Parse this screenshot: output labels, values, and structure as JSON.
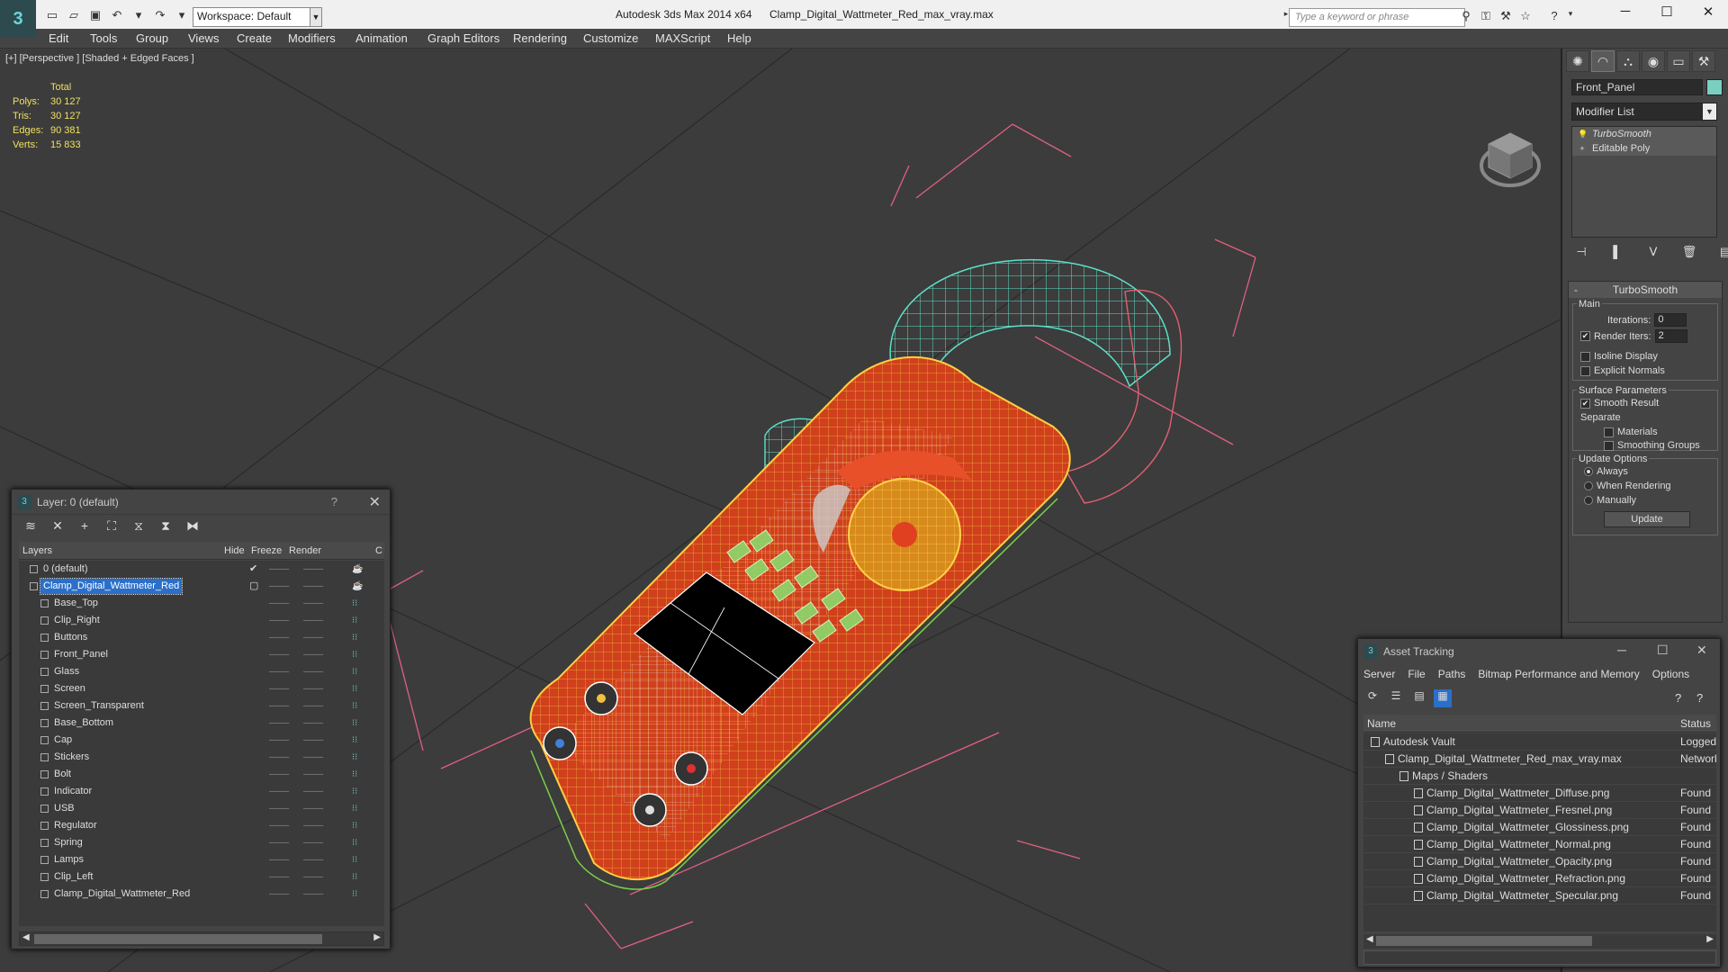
{
  "app": {
    "title": "Autodesk 3ds Max  2014 x64",
    "file": "Clamp_Digital_Wattmeter_Red_max_vray.max",
    "workspace": "Workspace: Default",
    "search_placeholder": "Type a keyword or phrase"
  },
  "menu": [
    "Edit",
    "Tools",
    "Group",
    "Views",
    "Create",
    "Modifiers",
    "Animation",
    "Graph Editors",
    "Rendering",
    "Customize",
    "MAXScript",
    "Help"
  ],
  "viewport": {
    "label": "[+] [Perspective ] [Shaded + Edged Faces ]",
    "stats": {
      "header": "Total",
      "polys_label": "Polys:",
      "polys": "30 127",
      "tris_label": "Tris:",
      "tris": "30 127",
      "edges_label": "Edges:",
      "edges": "90 381",
      "verts_label": "Verts:",
      "verts": "15 833"
    }
  },
  "command_panel": {
    "object_name": "Front_Panel",
    "object_color": "#7ad0c0",
    "modifier_list": "Modifier List",
    "stack": [
      "TurboSmooth",
      "Editable Poly"
    ],
    "rollout_title": "TurboSmooth",
    "main_group": "Main",
    "iterations_label": "Iterations:",
    "iterations": "0",
    "render_iters_label": "Render Iters:",
    "render_iters": "2",
    "isoline": "Isoline Display",
    "explicit_normals": "Explicit Normals",
    "surface_group": "Surface Parameters",
    "smooth_result": "Smooth Result",
    "separate": "Separate",
    "materials": "Materials",
    "smoothing_groups": "Smoothing Groups",
    "update_group": "Update Options",
    "always": "Always",
    "when_rendering": "When Rendering",
    "manually": "Manually",
    "update_btn": "Update"
  },
  "layer_window": {
    "title": "Layer: 0 (default)",
    "help": "?",
    "columns": {
      "layers": "Layers",
      "hide": "Hide",
      "freeze": "Freeze",
      "render": "Render",
      "c": "C"
    },
    "rows": [
      {
        "name": "0 (default)",
        "level": 0
      },
      {
        "name": "Clamp_Digital_Wattmeter_Red",
        "level": 0
      },
      {
        "name": "Base_Top",
        "level": 1
      },
      {
        "name": "Clip_Right",
        "level": 1
      },
      {
        "name": "Buttons",
        "level": 1
      },
      {
        "name": "Front_Panel",
        "level": 1
      },
      {
        "name": "Glass",
        "level": 1
      },
      {
        "name": "Screen",
        "level": 1
      },
      {
        "name": "Screen_Transparent",
        "level": 1
      },
      {
        "name": "Base_Bottom",
        "level": 1
      },
      {
        "name": "Cap",
        "level": 1
      },
      {
        "name": "Stickers",
        "level": 1
      },
      {
        "name": "Bolt",
        "level": 1
      },
      {
        "name": "Indicator",
        "level": 1
      },
      {
        "name": "USB",
        "level": 1
      },
      {
        "name": "Regulator",
        "level": 1
      },
      {
        "name": "Spring",
        "level": 1
      },
      {
        "name": "Lamps",
        "level": 1
      },
      {
        "name": "Clip_Left",
        "level": 1
      },
      {
        "name": "Clamp_Digital_Wattmeter_Red",
        "level": 1
      }
    ]
  },
  "asset_window": {
    "title": "Asset Tracking",
    "menu": [
      "Server",
      "File",
      "Paths",
      "Bitmap Performance and Memory",
      "Options"
    ],
    "columns": {
      "name": "Name",
      "status": "Status"
    },
    "rows": [
      {
        "name": "Autodesk Vault",
        "status": "Logged",
        "level": 0
      },
      {
        "name": "Clamp_Digital_Wattmeter_Red_max_vray.max",
        "status": "Network",
        "level": 1
      },
      {
        "name": "Maps / Shaders",
        "status": "",
        "level": 2
      },
      {
        "name": "Clamp_Digital_Wattmeter_Diffuse.png",
        "status": "Found",
        "level": 3
      },
      {
        "name": "Clamp_Digital_Wattmeter_Fresnel.png",
        "status": "Found",
        "level": 3
      },
      {
        "name": "Clamp_Digital_Wattmeter_Glossiness.png",
        "status": "Found",
        "level": 3
      },
      {
        "name": "Clamp_Digital_Wattmeter_Normal.png",
        "status": "Found",
        "level": 3
      },
      {
        "name": "Clamp_Digital_Wattmeter_Opacity.png",
        "status": "Found",
        "level": 3
      },
      {
        "name": "Clamp_Digital_Wattmeter_Refraction.png",
        "status": "Found",
        "level": 3
      },
      {
        "name": "Clamp_Digital_Wattmeter_Specular.png",
        "status": "Found",
        "level": 3
      }
    ]
  }
}
